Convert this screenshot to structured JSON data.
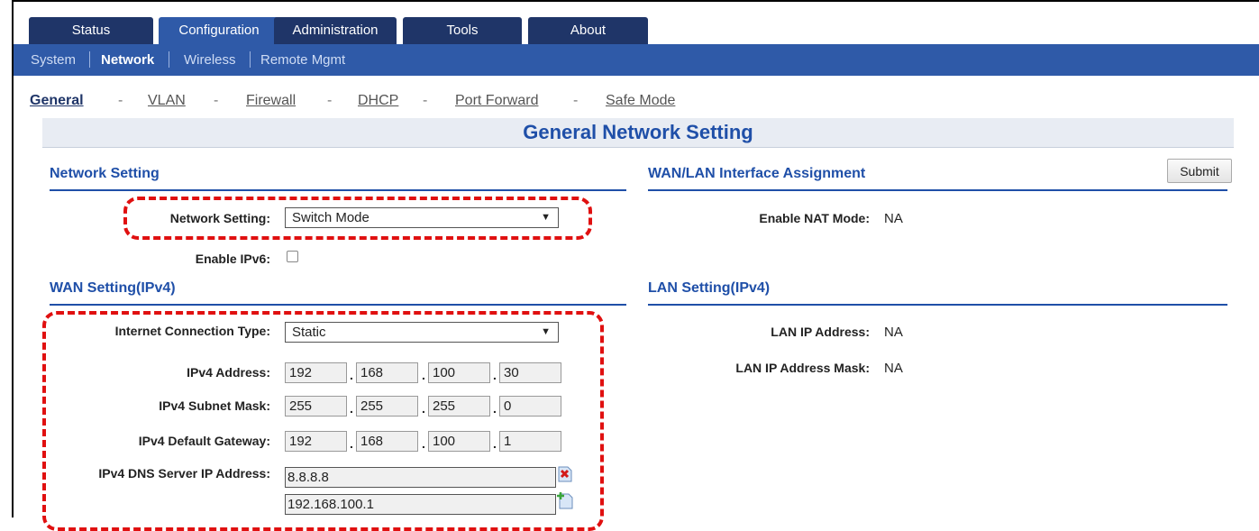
{
  "top_tabs": [
    "Status",
    "Configuration",
    "Administration",
    "Tools",
    "About"
  ],
  "sub_nav": [
    "System",
    "Network",
    "Wireless",
    "Remote Mgmt"
  ],
  "section_links": [
    "General",
    "VLAN",
    "Firewall",
    "DHCP",
    "Port Forward",
    "Safe Mode"
  ],
  "page_title": "General Network Setting",
  "submit_label": "Submit",
  "network_setting": {
    "heading": "Network Setting",
    "mode_label": "Network Setting:",
    "mode_value": "Switch Mode",
    "ipv6_label": "Enable IPv6:"
  },
  "wan_lan_assign": {
    "heading": "WAN/LAN Interface Assignment",
    "nat_label": "Enable NAT Mode:",
    "nat_value": "NA"
  },
  "wan": {
    "heading": "WAN Setting(IPv4)",
    "conn_type_label": "Internet Connection Type:",
    "conn_type_value": "Static",
    "ipv4_address_label": "IPv4 Address:",
    "ipv4_address": [
      "192",
      "168",
      "100",
      "30"
    ],
    "subnet_label": "IPv4 Subnet Mask:",
    "subnet": [
      "255",
      "255",
      "255",
      "0"
    ],
    "gateway_label": "IPv4 Default Gateway:",
    "gateway": [
      "192",
      "168",
      "100",
      "1"
    ],
    "dns_label": "IPv4 DNS Server IP Address:",
    "dns": [
      "8.8.8.8",
      "192.168.100.1"
    ]
  },
  "lan": {
    "heading": "LAN Setting(IPv4)",
    "ip_label": "LAN IP Address:",
    "ip_value": "NA",
    "mask_label": "LAN IP Address Mask:",
    "mask_value": "NA"
  },
  "colors": {
    "nav_dark": "#1f3568",
    "nav_active": "#2f5aa8",
    "heading_blue": "#1f4fa8",
    "highlight": "#e01010"
  }
}
